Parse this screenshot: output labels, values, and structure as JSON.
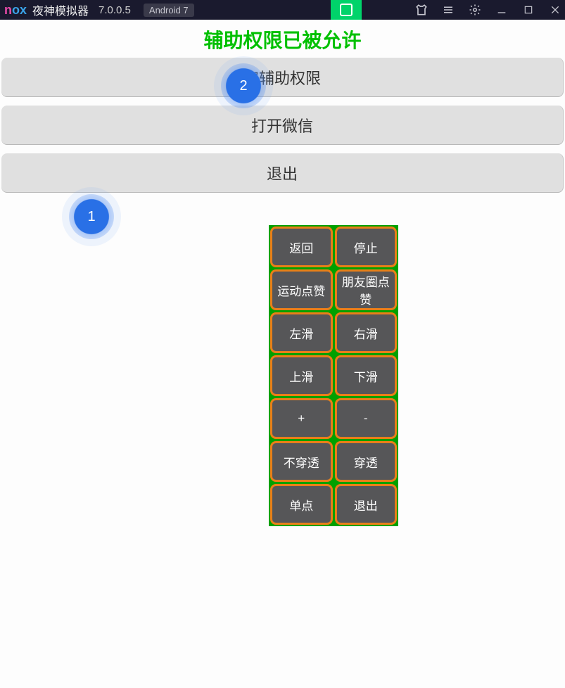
{
  "titlebar": {
    "app_name": "夜神模拟器",
    "version": "7.0.0.5",
    "android_badge": "Android 7"
  },
  "status_text": "辅助权限已被允许",
  "main_buttons": {
    "grant": "取辅助权限",
    "open_wechat": "打开微信",
    "exit": "退出"
  },
  "panel": {
    "back": "返回",
    "stop": "停止",
    "sport_like": "运动点赞",
    "moments_like": "朋友圈点赞",
    "swipe_left": "左滑",
    "swipe_right": "右滑",
    "swipe_up": "上滑",
    "swipe_down": "下滑",
    "plus": "+",
    "minus": "-",
    "no_passthrough": "不穿透",
    "passthrough": "穿透",
    "single_click": "单点",
    "exit": "退出"
  },
  "steps": {
    "one": "1",
    "two": "2"
  }
}
